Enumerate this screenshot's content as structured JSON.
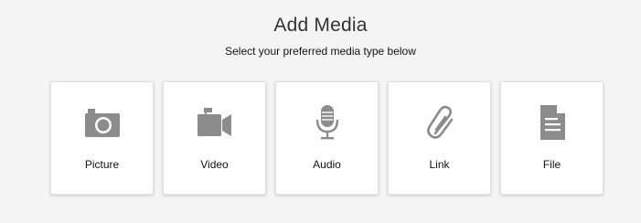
{
  "header": {
    "title": "Add Media",
    "subtitle": "Select your preferred media type below"
  },
  "media_types": [
    {
      "label": "Picture",
      "icon": "camera-icon"
    },
    {
      "label": "Video",
      "icon": "video-camera-icon"
    },
    {
      "label": "Audio",
      "icon": "microphone-icon"
    },
    {
      "label": "Link",
      "icon": "paperclip-icon"
    },
    {
      "label": "File",
      "icon": "document-icon"
    }
  ],
  "colors": {
    "background": "#f4f4f4",
    "card": "#ffffff",
    "icon": "#8c8c8c"
  }
}
